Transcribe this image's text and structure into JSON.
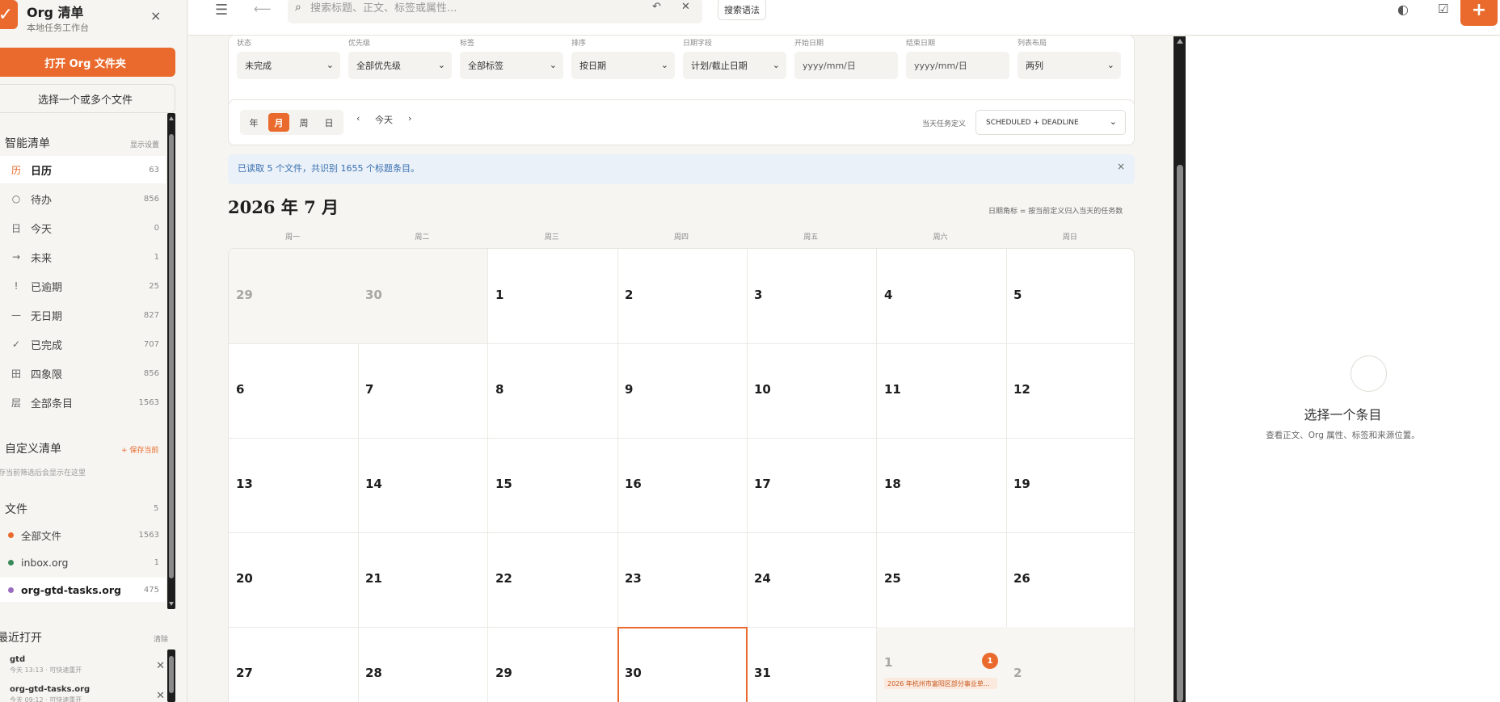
{
  "sidebar": {
    "brand_icon": "check-icon",
    "title": "Org 清单",
    "subtitle": "本地任务工作台",
    "close": "×",
    "open_folder": "打开 Org 文件夹",
    "select_files": "选择一个或多个文件",
    "smart_lists": {
      "heading": "智能清单",
      "action": "显示设置",
      "items": [
        {
          "glyph": "历",
          "label": "日历",
          "count": "63",
          "active": true
        },
        {
          "glyph": "○",
          "label": "待办",
          "count": "856"
        },
        {
          "glyph": "日",
          "label": "今天",
          "count": "0"
        },
        {
          "glyph": "→",
          "label": "未来",
          "count": "1"
        },
        {
          "glyph": "!",
          "label": "已逾期",
          "count": "25"
        },
        {
          "glyph": "—",
          "label": "无日期",
          "count": "827"
        },
        {
          "glyph": "✓",
          "label": "已完成",
          "count": "707"
        },
        {
          "glyph": "田",
          "label": "四象限",
          "count": "856"
        },
        {
          "glyph": "层",
          "label": "全部条目",
          "count": "1563"
        }
      ]
    },
    "custom_lists": {
      "heading": "自定义清单",
      "action": "+ 保存当前",
      "empty": "存当前筛选后会显示在这里"
    },
    "files": {
      "heading": "文件",
      "count": "5",
      "items": [
        {
          "label": "全部文件",
          "count": "1563",
          "color": "#e96a2c"
        },
        {
          "label": "inbox.org",
          "count": "1",
          "color": "#3a8a5a"
        },
        {
          "label": "org-gtd-tasks.org",
          "count": "475",
          "color": "#9a6cc0",
          "active": true
        }
      ]
    },
    "recent": {
      "heading": "最近打开",
      "clear": "清除",
      "items": [
        {
          "name": "gtd",
          "meta": "今天 13:13 · 可快速重开"
        },
        {
          "name": "org-gtd-tasks.org",
          "meta": "今天 09:12 · 可快速重开"
        }
      ]
    }
  },
  "topbar": {
    "search_placeholder": "搜索标题、正文、标签或属性...",
    "syntax_button": "搜索语法",
    "add_label": "+"
  },
  "filters": [
    {
      "label": "状态",
      "value": "未完成"
    },
    {
      "label": "优先级",
      "value": "全部优先级"
    },
    {
      "label": "标签",
      "value": "全部标签"
    },
    {
      "label": "排序",
      "value": "按日期"
    },
    {
      "label": "日期字段",
      "value": "计划/截止日期"
    },
    {
      "label": "开始日期",
      "value": "yyyy/mm/日",
      "type": "date"
    },
    {
      "label": "结束日期",
      "value": "yyyy/mm/日",
      "type": "date"
    },
    {
      "label": "列表布局",
      "value": "两列"
    }
  ],
  "viewbar": {
    "views": [
      {
        "label": "年"
      },
      {
        "label": "月",
        "active": true
      },
      {
        "label": "周"
      },
      {
        "label": "日"
      }
    ],
    "prev": "‹",
    "today": "今天",
    "next": "›",
    "task_def_label": "当天任务定义",
    "task_def_value": "SCHEDULED + DEADLINE"
  },
  "banner": {
    "message": "已读取 5 个文件，共识别 1655 个标题条目。",
    "close": "×"
  },
  "calendar": {
    "month_title": "2026 年 7 月",
    "note": "日期角标 = 按当前定义归入当天的任务数",
    "weekdays": [
      "周一",
      "周二",
      "周三",
      "周四",
      "周五",
      "周六",
      "周日"
    ],
    "weeks": [
      [
        {
          "d": "29",
          "out": true
        },
        {
          "d": "30",
          "out": true
        },
        {
          "d": "1"
        },
        {
          "d": "2"
        },
        {
          "d": "3"
        },
        {
          "d": "4"
        },
        {
          "d": "5"
        }
      ],
      [
        {
          "d": "6"
        },
        {
          "d": "7"
        },
        {
          "d": "8"
        },
        {
          "d": "9"
        },
        {
          "d": "10"
        },
        {
          "d": "11"
        },
        {
          "d": "12"
        }
      ],
      [
        {
          "d": "13"
        },
        {
          "d": "14"
        },
        {
          "d": "15"
        },
        {
          "d": "16"
        },
        {
          "d": "17"
        },
        {
          "d": "18"
        },
        {
          "d": "19"
        }
      ],
      [
        {
          "d": "20"
        },
        {
          "d": "21"
        },
        {
          "d": "22"
        },
        {
          "d": "23"
        },
        {
          "d": "24"
        },
        {
          "d": "25"
        },
        {
          "d": "26"
        }
      ],
      [
        {
          "d": "27"
        },
        {
          "d": "28"
        },
        {
          "d": "29"
        },
        {
          "d": "30",
          "today": true
        },
        {
          "d": "31"
        },
        {
          "d": "1",
          "out": true,
          "badge": "1",
          "event": "2026 年杭州市富阳区部分事业单..."
        },
        {
          "d": "2",
          "out": true
        }
      ]
    ]
  },
  "detail": {
    "title": "选择一个条目",
    "subtitle": "查看正文、Org 属性、标签和来源位置。"
  }
}
